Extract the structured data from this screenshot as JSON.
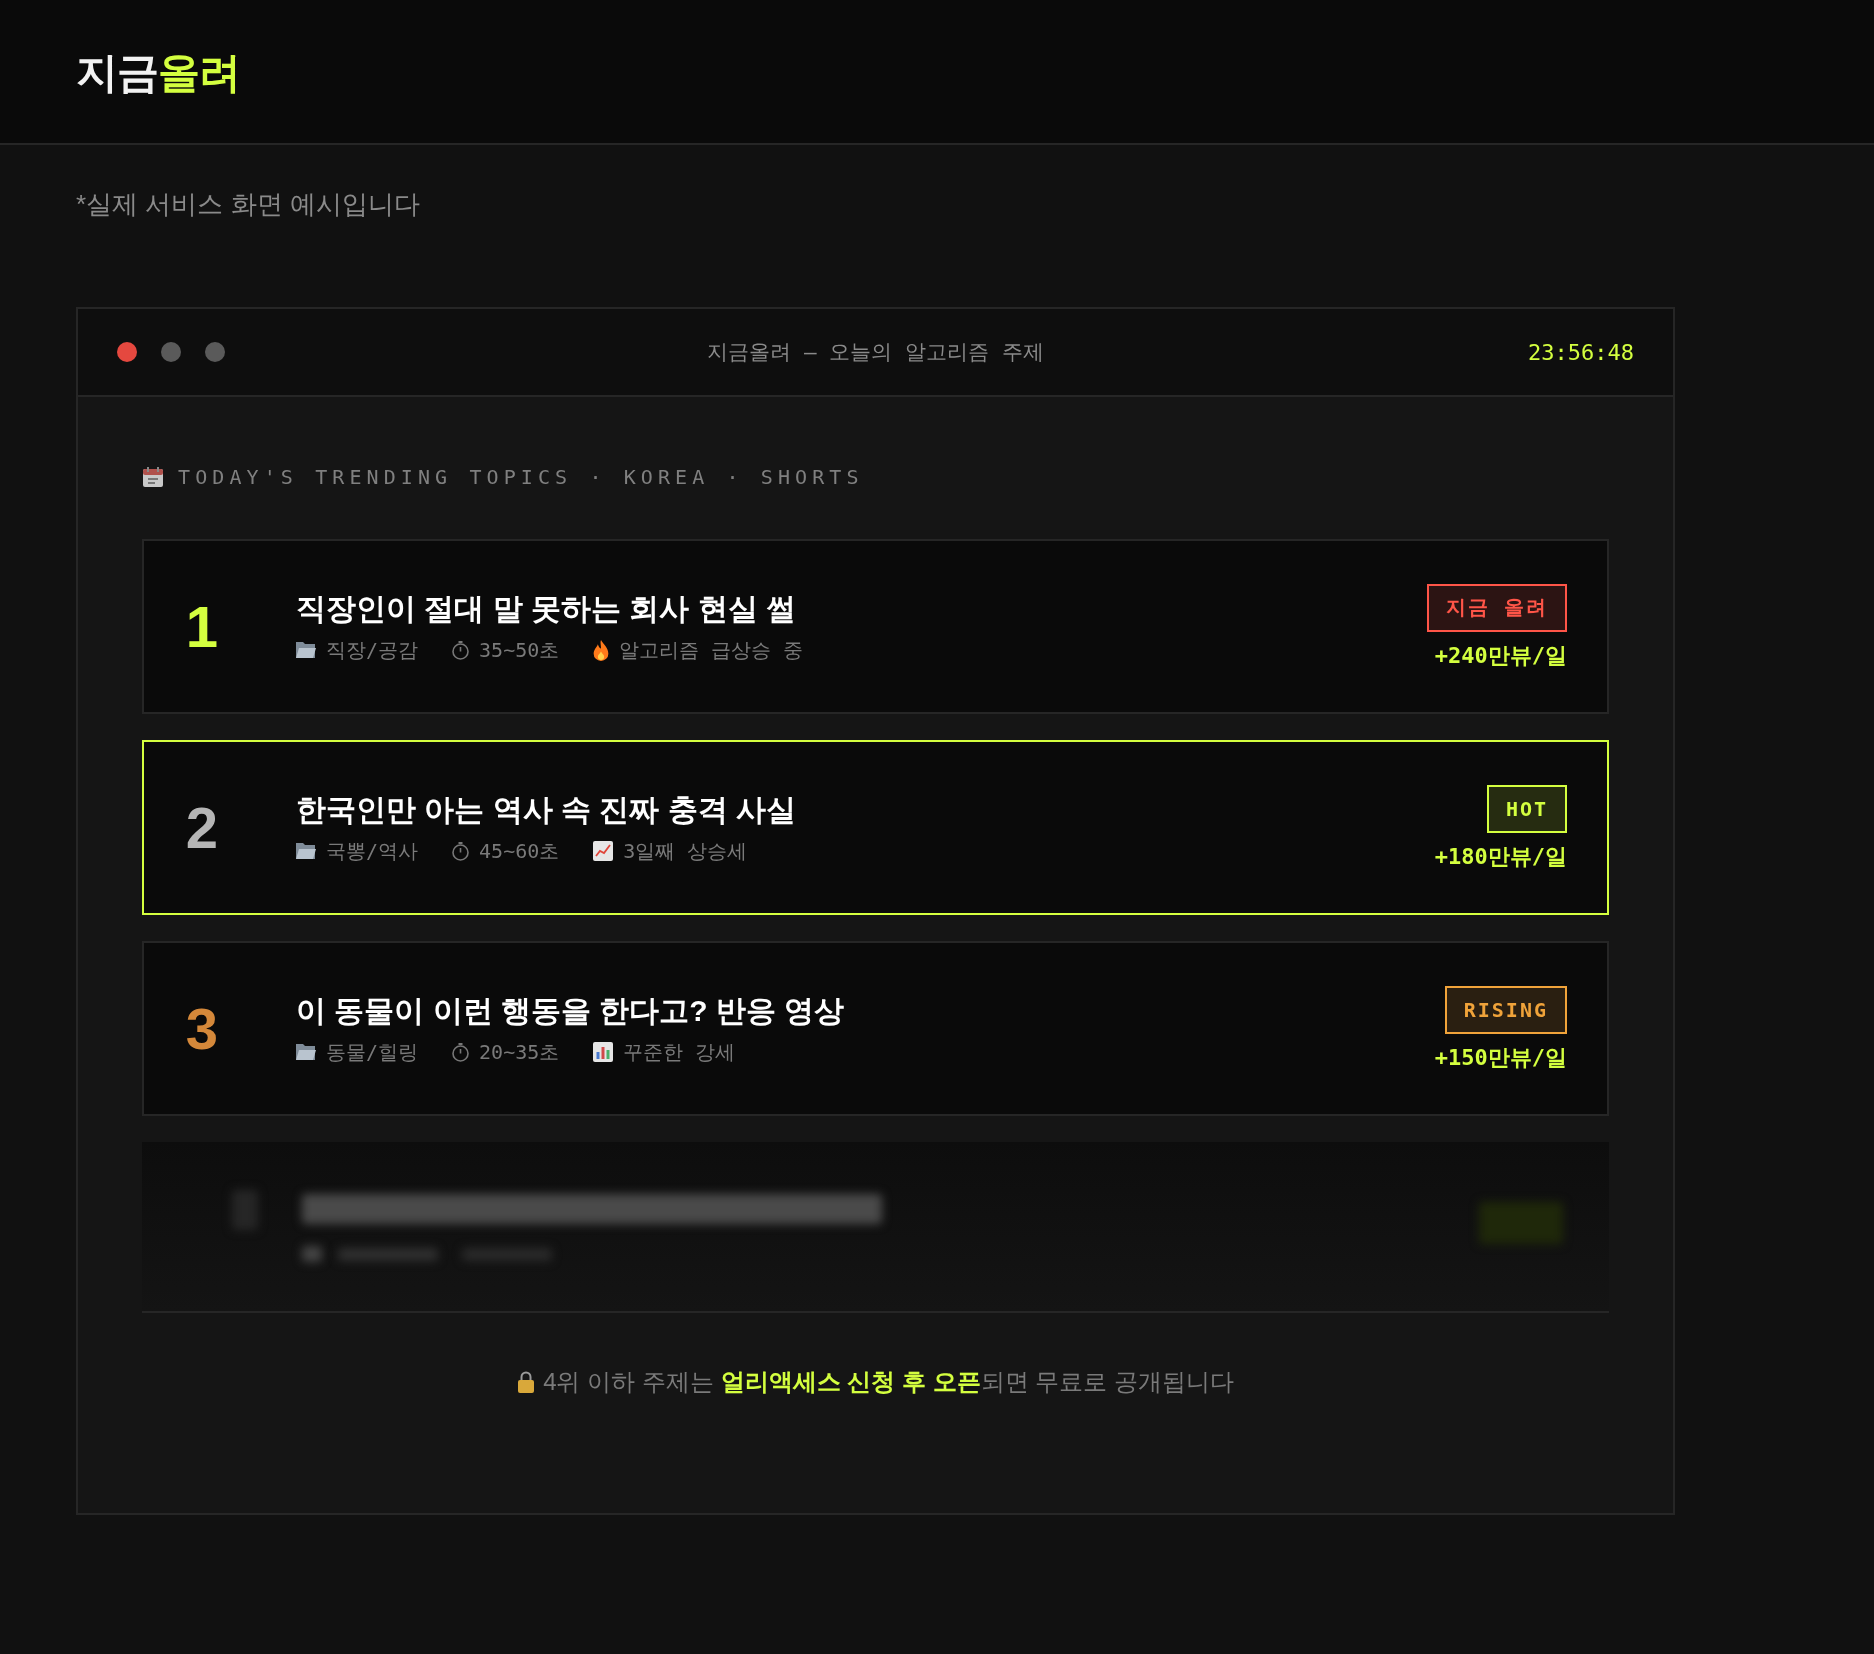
{
  "header": {
    "logo": {
      "text": "지금",
      "accent": "올려"
    }
  },
  "notice": "*실제 서비스 화면 예시입니다",
  "window": {
    "title": "지금올려 — 오늘의 알고리즘 주제",
    "clock": "23:56:48",
    "section_label": "TODAY'S TRENDING TOPICS · KOREA · SHORTS",
    "topics": [
      {
        "rank": {
          "text": "1",
          "color": "#d4ff3f"
        },
        "title": "직장인이 절대 말 못하는 회사 현실 썰",
        "category": "직장/공감",
        "duration": "35~50초",
        "signal": {
          "kind": "surge",
          "text": "알고리즘 급상승 중"
        },
        "badge": {
          "text": "지금 올려",
          "color": "#ff5548"
        },
        "views": "+240만뷰/일",
        "selected": false
      },
      {
        "rank": {
          "text": "2",
          "color": "#b5b5b5"
        },
        "title": "한국인만 아는 역사 속 진짜 충격 사실",
        "category": "국뽕/역사",
        "duration": "45~60초",
        "signal": {
          "kind": "uptrend",
          "text": "3일째 상승세"
        },
        "badge": {
          "text": "HOT",
          "color": "#d4ff3f"
        },
        "views": "+180만뷰/일",
        "selected": true
      },
      {
        "rank": {
          "text": "3",
          "color": "#d4883a"
        },
        "title": "이 동물이 이런 행동을 한다고? 반응 영상",
        "category": "동물/힐링",
        "duration": "20~35초",
        "signal": {
          "kind": "steady",
          "text": "꾸준한 강세"
        },
        "badge": {
          "text": "RISING",
          "color": "#f0a33a"
        },
        "views": "+150만뷰/일",
        "selected": false
      }
    ],
    "locked_preview": {
      "blurred": true
    },
    "footer": "4위 이하 주제는 **얼리액세스 신청 후 오픈**되면 무료로 공개됩니다"
  }
}
